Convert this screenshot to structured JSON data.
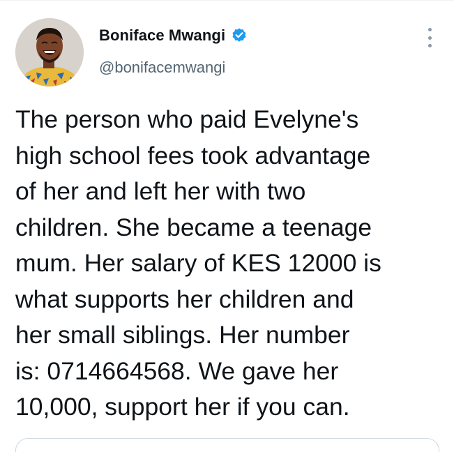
{
  "author": {
    "display_name": "Boniface Mwangi",
    "handle": "@bonifacemwangi",
    "verified_icon": "verified-badge-icon",
    "avatar_icon": "avatar-photo"
  },
  "menu": {
    "icon": "more-vertical-icon"
  },
  "tweet": {
    "text": "The person who paid Evelyne's\nhigh school fees took advantage\nof her and left her with two\nchildren. She became a teenage\nmum. Her salary of KES 12000 is\nwhat supports her children and\nher small siblings. Her number\nis: 0714664568. We gave her\n10,000, support her if you can."
  },
  "colors": {
    "text": "#0f1419",
    "secondary": "#536471",
    "verified": "#1d9bf0",
    "border": "#cfd9de"
  }
}
